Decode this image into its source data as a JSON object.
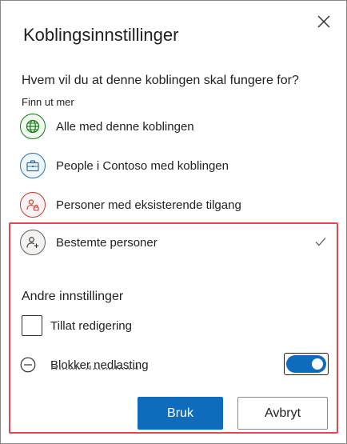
{
  "dialog": {
    "title": "Koblingsinnstillinger",
    "close_icon": "close-icon"
  },
  "question": "Hvem vil du at denne koblingen skal fungere for?",
  "learn_more": "Finn ut mer",
  "options": [
    {
      "label": "Alle med denne koblingen",
      "icon": "globe-icon",
      "selected": false
    },
    {
      "label": "People i Contoso med koblingen",
      "icon": "briefcase-icon",
      "selected": false
    },
    {
      "label": "Personer med eksisterende tilgang",
      "icon": "people-lock-icon",
      "selected": false
    },
    {
      "label": "Bestemte personer",
      "icon": "person-add-icon",
      "selected": true
    }
  ],
  "other_settings": {
    "heading": "Andre innstillinger",
    "allow_editing": {
      "label": "Tillat redigering",
      "checked": false
    },
    "block_download": {
      "label": "Blokker nedlasting",
      "ghost_label": "Block download",
      "enabled": true
    }
  },
  "buttons": {
    "apply": "Bruk",
    "cancel": "Avbryt"
  },
  "colors": {
    "accent": "#0f6cbd",
    "highlight": "#e8454f"
  }
}
